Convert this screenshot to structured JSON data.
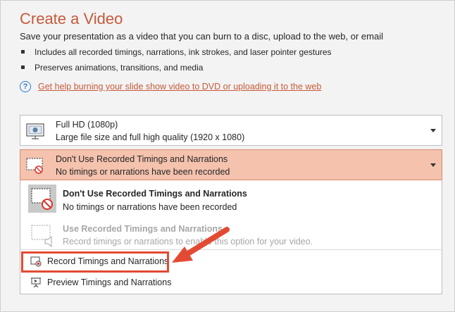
{
  "title": "Create a Video",
  "subtitle": "Save your presentation as a video that you can burn to a disc, upload to the web, or email",
  "bullets": [
    "Includes all recorded timings, narrations, ink strokes, and laser pointer gestures",
    "Preserves animations, transitions, and media"
  ],
  "help_link": "Get help burning your slide show video to DVD or uploading it to the web",
  "quality_select": {
    "title": "Full HD (1080p)",
    "description": "Large file size and full high quality (1920 x 1080)"
  },
  "timing_select": {
    "title": "Don't Use Recorded Timings and Narrations",
    "description": "No timings or narrations have been recorded"
  },
  "dropdown": {
    "options": [
      {
        "title": "Don't Use Recorded Timings and Narrations",
        "description": "No timings or narrations have been recorded"
      },
      {
        "title": "Use Recorded Timings and Narrations",
        "description": "Record timings or narrations to enable this option for your video."
      }
    ],
    "menu_items": [
      {
        "label": "Record Timings and Narrations"
      },
      {
        "label": "Preview Timings and Narrations"
      }
    ]
  },
  "colors": {
    "accent": "#c55a3b",
    "selected_bg": "#f4c2ad",
    "annotation": "#e34a33",
    "link_icon": "#2b7cd3"
  }
}
